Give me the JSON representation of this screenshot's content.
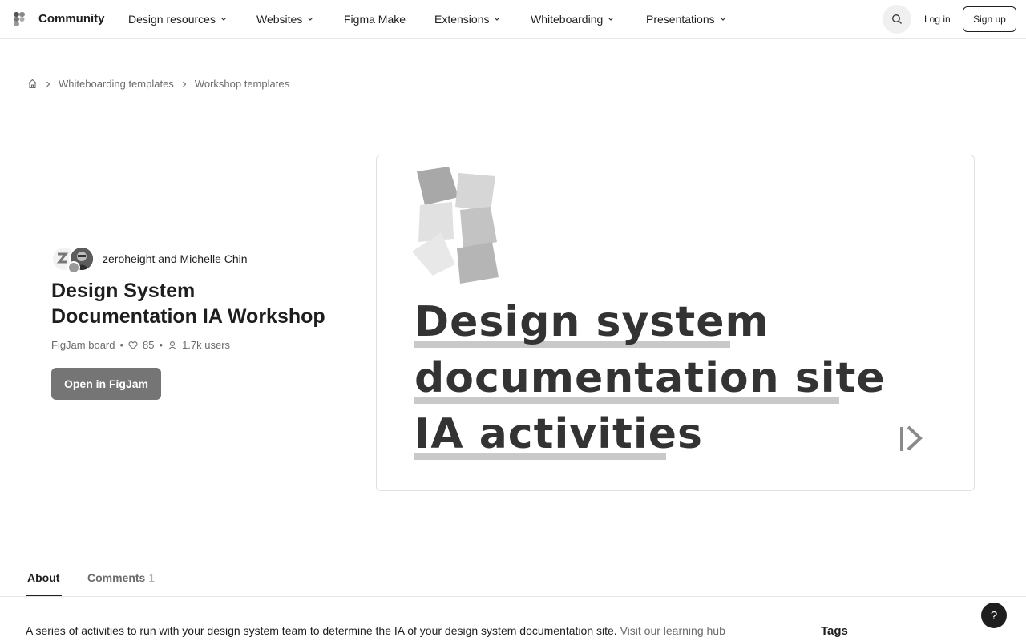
{
  "nav": {
    "brand": "Community",
    "items": [
      {
        "label": "Design resources",
        "has_menu": true
      },
      {
        "label": "Websites",
        "has_menu": true
      },
      {
        "label": "Figma Make",
        "has_menu": false
      },
      {
        "label": "Extensions",
        "has_menu": true
      },
      {
        "label": "Whiteboarding",
        "has_menu": true
      },
      {
        "label": "Presentations",
        "has_menu": true
      }
    ],
    "search_icon": "search-icon",
    "login": "Log in",
    "signup": "Sign up"
  },
  "breadcrumb": {
    "home_icon": "home-icon",
    "items": [
      "Whiteboarding templates",
      "Workshop templates"
    ]
  },
  "file": {
    "authors": "zeroheight and Michelle Chin",
    "title": "Design System Documentation IA Workshop",
    "type": "FigJam board",
    "likes": "85",
    "users": "1.7k users",
    "open_button": "Open in FigJam"
  },
  "preview": {
    "lines": [
      "Design system",
      "documentation site",
      "IA activities"
    ]
  },
  "tabs": {
    "about": "About",
    "comments": "Comments",
    "comments_count": "1"
  },
  "about": {
    "description": "A series of activities to run with your design system team to determine the IA of your design system documentation site.",
    "link_text": "Visit our learning hub",
    "tags_heading": "Tags"
  },
  "help": "?"
}
